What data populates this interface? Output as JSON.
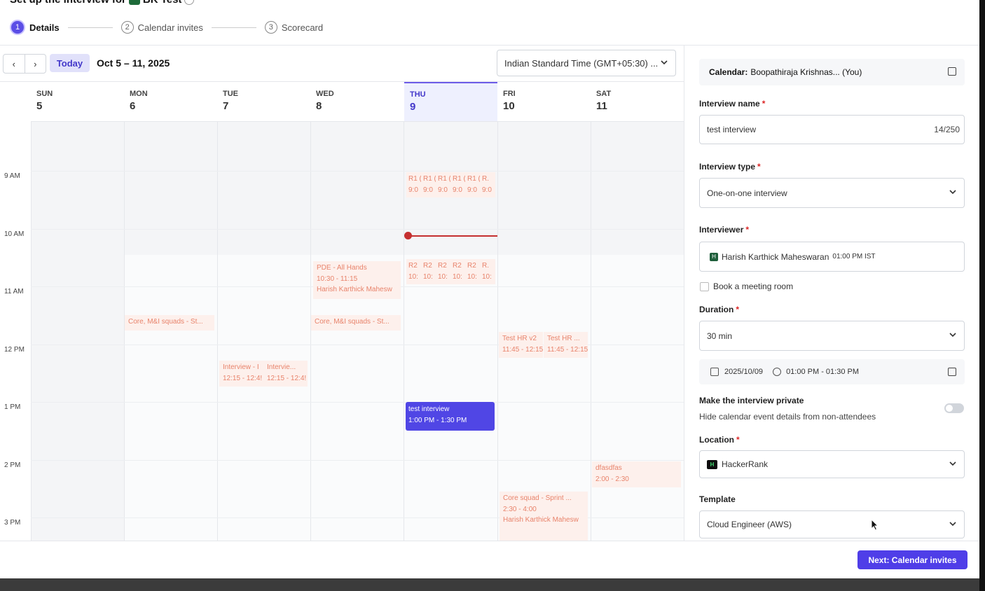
{
  "title": {
    "text": "Set up the interview for",
    "candidate": "BK Test"
  },
  "stepper": [
    {
      "num": "1",
      "label": "Details"
    },
    {
      "num": "2",
      "label": "Calendar invites"
    },
    {
      "num": "3",
      "label": "Scorecard"
    }
  ],
  "calendar": {
    "prev": "‹",
    "next": "›",
    "today_label": "Today",
    "range": "Oct 5 – 11, 2025",
    "timezone": "Indian Standard Time (GMT+05:30) ...",
    "days": [
      {
        "name": "SUN",
        "date": "5"
      },
      {
        "name": "MON",
        "date": "6"
      },
      {
        "name": "TUE",
        "date": "7"
      },
      {
        "name": "WED",
        "date": "8"
      },
      {
        "name": "THU",
        "date": "9"
      },
      {
        "name": "FRI",
        "date": "10"
      },
      {
        "name": "SAT",
        "date": "11"
      }
    ],
    "hours": [
      "9 AM",
      "10 AM",
      "11 AM",
      "12 PM",
      "1 PM",
      "2 PM",
      "3 PM"
    ],
    "events": {
      "r1": [
        {
          "t": "R1 (",
          "s": "9:0"
        },
        {
          "t": "R1 (",
          "s": "9:0"
        },
        {
          "t": "R1 (",
          "s": "9:0"
        },
        {
          "t": "R1 (",
          "s": "9:0"
        },
        {
          "t": "R1 (",
          "s": "9:0"
        },
        {
          "t": "R.",
          "s": "9:0"
        }
      ],
      "r2": [
        {
          "t": "R2",
          "s": "10:"
        },
        {
          "t": "R2",
          "s": "10:"
        },
        {
          "t": "R2",
          "s": "10:"
        },
        {
          "t": "R2",
          "s": "10:"
        },
        {
          "t": "R2",
          "s": "10:"
        },
        {
          "t": "R.",
          "s": "10:"
        }
      ],
      "pde": {
        "title": "PDE - All Hands",
        "time": "10:30 - 11:15",
        "who": "Harish Karthick Mahesw"
      },
      "core_mon": {
        "title": "Core, M&I squads - St..."
      },
      "core_wed": {
        "title": "Core, M&I squads - St..."
      },
      "tue1": {
        "title": "Interview - I",
        "time": "12:15 - 12:4!"
      },
      "tue2": {
        "title": "Intervie...",
        "time": "12:15 - 12:4!"
      },
      "fri1": {
        "title": "Test HR v2",
        "time": "11:45 - 12:15"
      },
      "fri2": {
        "title": "Test HR ...",
        "time": "11:45 - 12:15"
      },
      "current": {
        "title": "test interview",
        "time": "1:00 PM - 1:30 PM"
      },
      "sat": {
        "title": "dfasdfas",
        "time": "2:00 - 2:30"
      },
      "sprint": {
        "title": "Core squad - Sprint ...",
        "time": "2:30 - 4:00",
        "who": "Harish Karthick Mahesw"
      }
    }
  },
  "form": {
    "calendar_label": "Calendar:",
    "calendar_value": "Boopathiraja Krishnas... (You)",
    "interview_name_label": "Interview name",
    "interview_name_value": "test interview",
    "interview_name_count": "14/250",
    "interview_type_label": "Interview type",
    "interview_type_value": "One-on-one interview",
    "interviewer_label": "Interviewer",
    "interviewer_initial": "H",
    "interviewer_name": "Harish Karthick Maheswaran",
    "interviewer_time": "01:00 PM IST",
    "meeting_room_label": "Book a meeting room",
    "duration_label": "Duration",
    "duration_value": "30 min",
    "date_value": "2025/10/09",
    "time_value": "01:00 PM - 01:30 PM",
    "private_label": "Make the interview private",
    "private_hint": "Hide calendar event details from non-attendees",
    "location_label": "Location",
    "location_logo": "H",
    "location_value": "HackerRank",
    "template_label": "Template",
    "template_value": "Cloud Engineer (AWS)",
    "required_mark": "*"
  },
  "footer": {
    "next_label": "Next: Calendar invites"
  }
}
